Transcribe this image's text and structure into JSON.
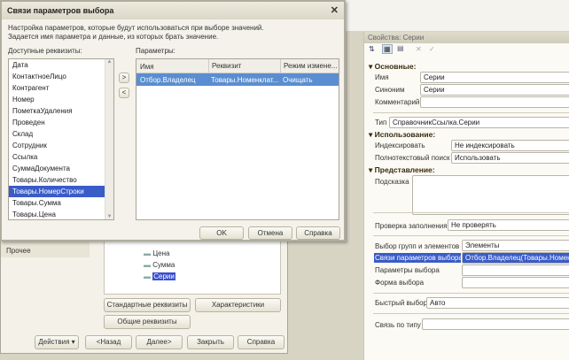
{
  "dialog": {
    "title": "Связи параметров выбора",
    "close": "✕",
    "description_line1": "Настройка параметров, которые будут использоваться при выборе значений.",
    "description_line2": "Задается имя параметра и данные, из которых брать значение.",
    "available_label": "Доступные реквизиты:",
    "params_label": "Параметры:",
    "available_items": [
      "Дата",
      "КонтактноеЛицо",
      "Контрагент",
      "Номер",
      "ПометкаУдаления",
      "Проведен",
      "Склад",
      "Сотрудник",
      "Ссылка",
      "СуммаДокумента",
      "Товары.Количество",
      "Товары.НомерСтроки",
      "Товары.Сумма",
      "Товары.Цена"
    ],
    "selected_index": 11,
    "add_button": ">",
    "remove_button": "<",
    "columns": [
      "Имя",
      "Реквизит",
      "Режим измене..."
    ],
    "rows": [
      [
        "Отбор.Владелец",
        "Товары.Номенклат...",
        "Очищать"
      ]
    ],
    "ok": "OK",
    "cancel": "Отмена",
    "help": "Справка"
  },
  "background_window": {
    "left_item": "Прочее",
    "tree_items": [
      "Цена",
      "Сумма",
      "Серии"
    ],
    "std_attrs": "Стандартные реквизиты",
    "characteristics": "Характеристики",
    "common_attrs": "Общие реквизиты",
    "actions": "Действия",
    "back": "<Назад",
    "next": "Далее>",
    "close": "Закрыть",
    "help": "Справка"
  },
  "properties": {
    "title": "Свойства: Серии",
    "section_main": "Основные:",
    "name_label": "Имя",
    "name_value": "Серии",
    "synonym_label": "Синоним",
    "synonym_value": "Серии",
    "comment_label": "Комментарий",
    "comment_value": "",
    "type_label": "Тип",
    "type_value": "СправочникСсылка.Серии",
    "section_usage": "Использование:",
    "index_label": "Индексировать",
    "index_value": "Не индексировать",
    "fulltext_label": "Полнотекстовый поиск",
    "fulltext_value": "Использовать",
    "section_view": "Представление:",
    "hint_label": "Подсказка",
    "fill_check_label": "Проверка заполнения",
    "fill_check_value": "Не проверять",
    "choice_groups_label": "Выбор групп и элементов",
    "choice_groups_value": "Элементы",
    "links_label": "Связи параметров выбора",
    "links_value": "Отбор.Владелец(Товары.Номенкл...",
    "choice_params_label": "Параметры выбора",
    "choice_form_label": "Форма выбора",
    "quick_choice_label": "Быстрый выбор",
    "quick_choice_value": "Авто",
    "type_link_label": "Связь по типу"
  }
}
